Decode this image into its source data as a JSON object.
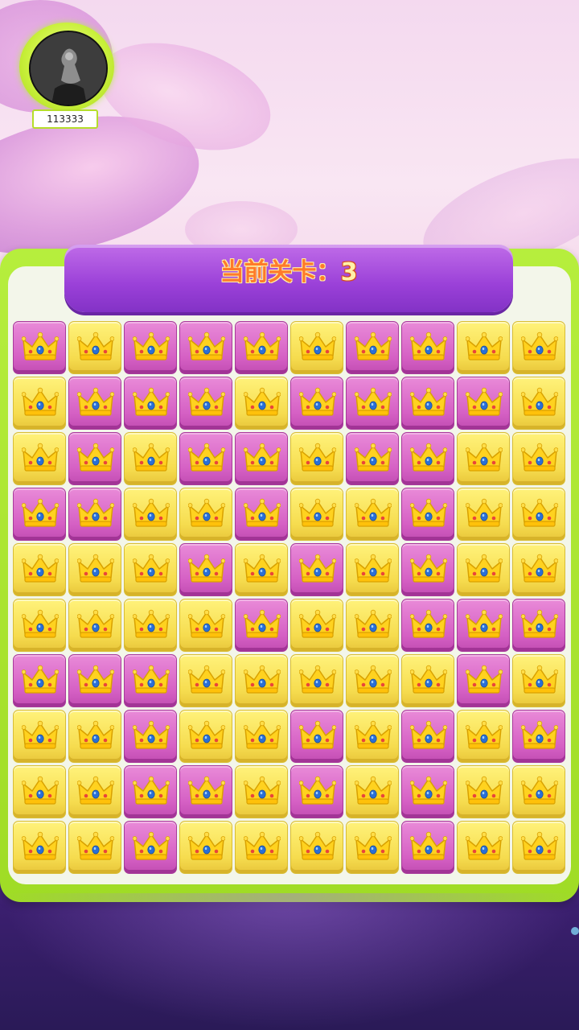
{
  "player": {
    "score": "113333"
  },
  "level": {
    "label": "当前关卡：",
    "value": "3"
  },
  "colors": {
    "yellow_tile": "#f6dc4f",
    "pink_tile": "#d560c4",
    "frame_green": "#b6ee3d",
    "banner_purple": "#9a40d8"
  },
  "board": {
    "columns": 10,
    "rows": 10,
    "tile_icon": "crown-icon",
    "grid": [
      [
        "P",
        "Y",
        "P",
        "P",
        "P",
        "Y",
        "P",
        "P",
        "Y",
        "Y"
      ],
      [
        "Y",
        "P",
        "P",
        "P",
        "Y",
        "P",
        "P",
        "P",
        "P",
        "Y"
      ],
      [
        "Y",
        "P",
        "Y",
        "P",
        "P",
        "Y",
        "P",
        "P",
        "Y",
        "Y"
      ],
      [
        "P",
        "P",
        "Y",
        "Y",
        "P",
        "Y",
        "Y",
        "P",
        "Y",
        "Y"
      ],
      [
        "Y",
        "Y",
        "Y",
        "P",
        "Y",
        "P",
        "Y",
        "P",
        "Y",
        "Y"
      ],
      [
        "Y",
        "Y",
        "Y",
        "Y",
        "P",
        "Y",
        "Y",
        "P",
        "P",
        "P"
      ],
      [
        "P",
        "P",
        "P",
        "Y",
        "Y",
        "Y",
        "Y",
        "Y",
        "P",
        "Y"
      ],
      [
        "Y",
        "Y",
        "P",
        "Y",
        "Y",
        "P",
        "Y",
        "P",
        "Y",
        "P"
      ],
      [
        "Y",
        "Y",
        "P",
        "P",
        "Y",
        "P",
        "Y",
        "P",
        "Y",
        "Y"
      ],
      [
        "Y",
        "Y",
        "P",
        "Y",
        "Y",
        "Y",
        "Y",
        "P",
        "Y",
        "Y"
      ]
    ]
  }
}
